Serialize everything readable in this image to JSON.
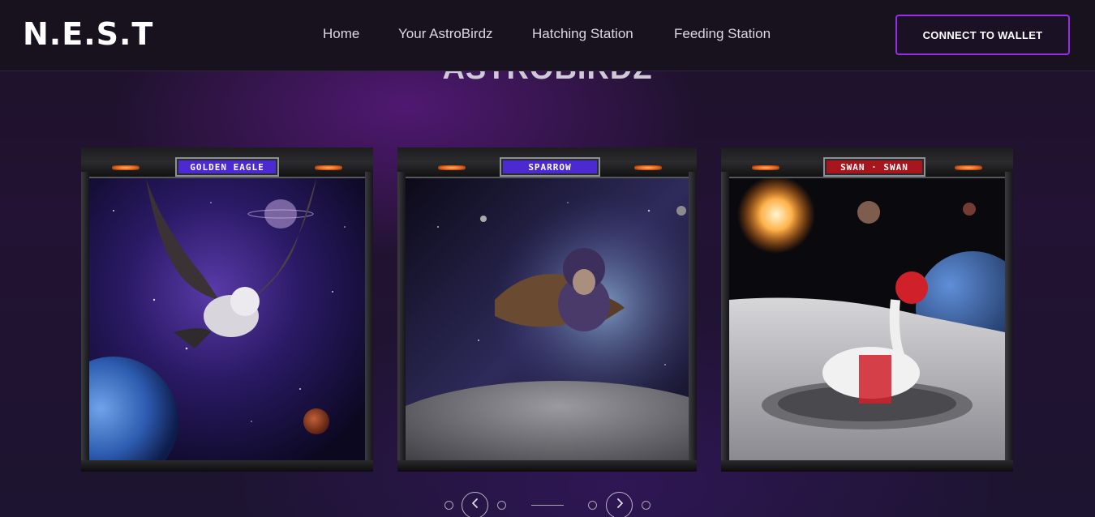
{
  "header": {
    "logo": "N.E.S.T",
    "nav": [
      {
        "label": "Home"
      },
      {
        "label": "Your AstroBirdz"
      },
      {
        "label": "Hatching Station"
      },
      {
        "label": "Feeding Station"
      }
    ],
    "connect_label": "CONNECT TO WALLET"
  },
  "section": {
    "title": "ASTROBIRDZ"
  },
  "cards": [
    {
      "name": "GOLDEN EAGLE",
      "plate_color": "#4b2bd1"
    },
    {
      "name": "SPARROW",
      "plate_color": "#4b2bd1"
    },
    {
      "name": "SWAN · SWAN",
      "plate_color": "#a8161d"
    }
  ],
  "colors": {
    "accent": "#9a2be6",
    "background": "#1a1224"
  },
  "carousel": {
    "prev_icon": "chevron-left-icon",
    "next_icon": "chevron-right-icon"
  }
}
